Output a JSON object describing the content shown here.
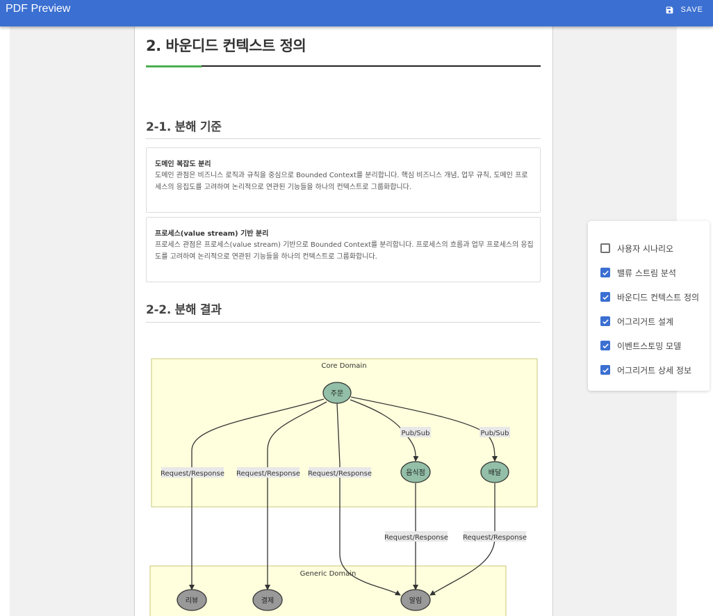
{
  "app": {
    "title": "PDF Preview",
    "save_label": "SAVE"
  },
  "document": {
    "section_title": "2. 바운디드 컨텍스트 정의",
    "subsection1_title": "2-1. 분해 기준",
    "cards": [
      {
        "title": "도메인 복잡도 분리",
        "body": "도메인 관점은 비즈니스 로직과 규칙을 중심으로 Bounded Context를 분리합니다. 핵심 비즈니스 개념, 업무 규칙, 도메인 프로세스의 응집도를 고려하여 논리적으로 연관된 기능들을 하나의 컨텍스트로 그룹화합니다."
      },
      {
        "title": "프로세스(value stream) 기반 분리",
        "body": "프로세스 관점은 프로세스(value stream) 기반으로 Bounded Context를 분리합니다. 프로세스의 흐름과 업무 프로세스의 응집도를 고려하여 논리적으로 연관된 기능들을 하나의 컨텍스트로 그룹화합니다."
      }
    ],
    "subsection2_title": "2-2. 분해 결과"
  },
  "diagram": {
    "domains": {
      "core": "Core Domain",
      "generic": "Generic Domain"
    },
    "nodes": {
      "order": "주문",
      "restaurant": "음식점",
      "delivery": "배달",
      "review": "리뷰",
      "payment": "결제",
      "notification": "알림"
    },
    "edge_labels": {
      "order_review": "Request/Response",
      "order_payment": "Request/Response",
      "order_notification": "Request/Response",
      "order_restaurant": "Pub/Sub",
      "order_delivery": "Pub/Sub",
      "restaurant_notification": "Request/Response",
      "delivery_notification": "Request/Response"
    },
    "colors": {
      "domain_fill": "#ffffdd",
      "domain_stroke": "#c8c87a",
      "core_node": "#93bfa8",
      "generic_node": "#999999"
    }
  },
  "options": [
    {
      "label": "사용자 시나리오",
      "checked": false
    },
    {
      "label": "밸류 스트림 분석",
      "checked": true
    },
    {
      "label": "바운디드 컨텍스트 정의",
      "checked": true
    },
    {
      "label": "어그리거트 설계",
      "checked": true
    },
    {
      "label": "이벤트스토밍 모델",
      "checked": true
    },
    {
      "label": "어그리거트 상세 정보",
      "checked": true
    }
  ],
  "colors": {
    "accent": "#3b6fd1",
    "heading_accent": "#4caf50"
  }
}
